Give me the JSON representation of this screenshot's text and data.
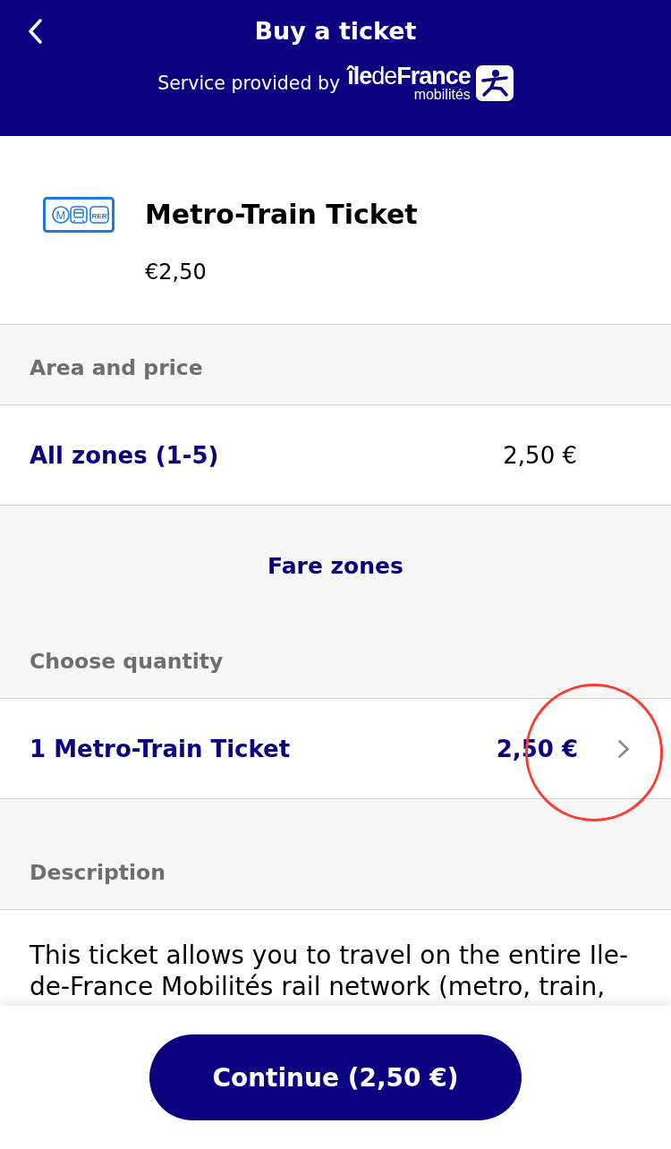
{
  "header": {
    "title": "Buy a ticket",
    "provided_by": "Service provided by",
    "logo": {
      "wordmark": "**île**de**France**",
      "subline": "mobilités"
    }
  },
  "product": {
    "name": "Metro-Train Ticket",
    "price": "€2,50",
    "icon_labels": {
      "metro": "M",
      "rer": "RER"
    }
  },
  "area_header": "Area and price",
  "zone_row": {
    "label": "All zones (1-5)",
    "price": "2,50 €"
  },
  "fare_zones_link": "Fare zones",
  "quantity_header": "Choose quantity",
  "quantity_row": {
    "label": "1 Metro-Train Ticket",
    "price": "2,50 €",
    "circled": true
  },
  "description_header": "Description",
  "description": "This ticket allows you to travel on the entire Ile-de-France Mobilités rail network (metro, train,",
  "continue_button": "Continue (2,50 €)"
}
